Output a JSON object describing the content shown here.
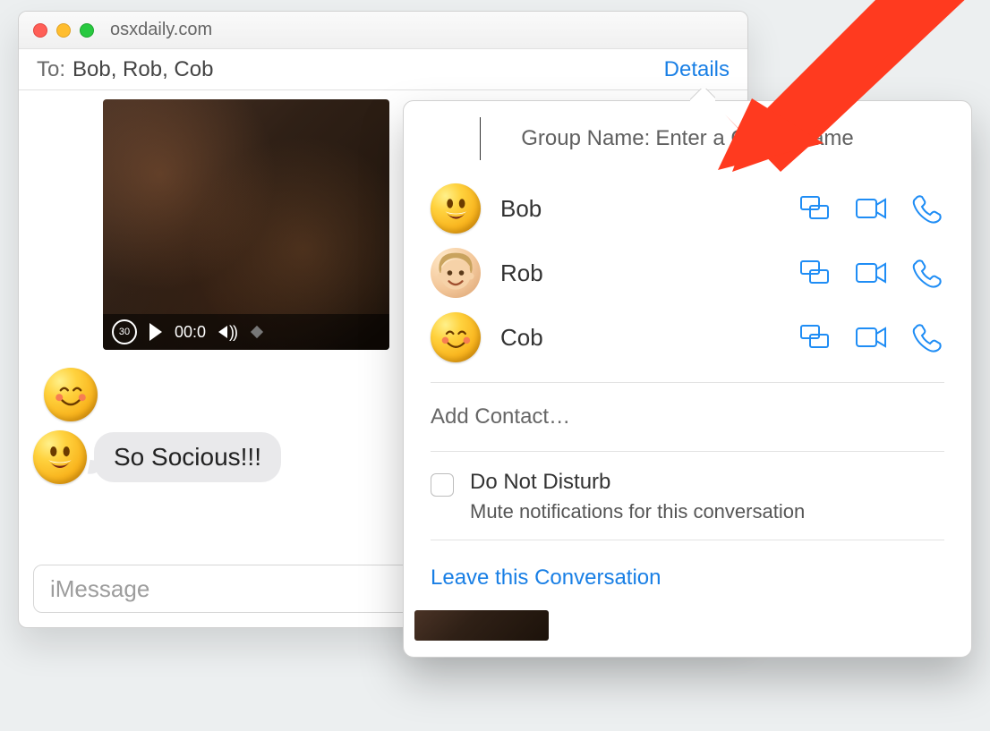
{
  "window": {
    "title": "osxdaily.com",
    "to_label": "To:",
    "recipients": "Bob, Rob, Cob",
    "details_label": "Details"
  },
  "video": {
    "rewind_label": "30",
    "time": "00:0"
  },
  "message": {
    "text": "So Socious!!!"
  },
  "compose": {
    "placeholder": "iMessage"
  },
  "popover": {
    "group_name_label": "Group Name:",
    "group_name_placeholder": "Enter a Group Name",
    "members": [
      {
        "name": "Bob"
      },
      {
        "name": "Rob"
      },
      {
        "name": "Cob"
      }
    ],
    "add_contact": "Add Contact…",
    "dnd_label": "Do Not Disturb",
    "dnd_sub": "Mute notifications for this conversation",
    "leave_label": "Leave this Conversation"
  }
}
